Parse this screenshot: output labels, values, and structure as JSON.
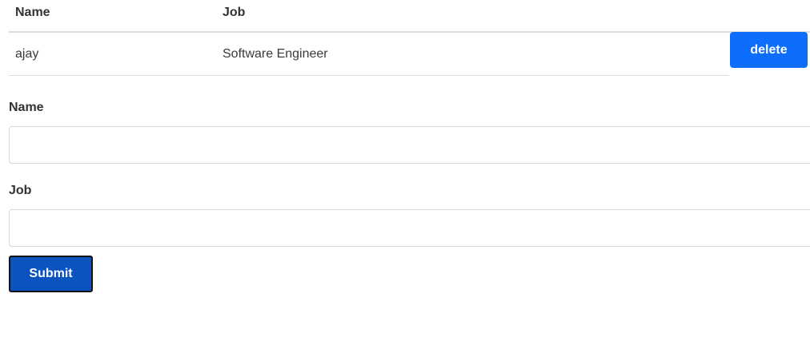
{
  "table": {
    "headers": {
      "name": "Name",
      "job": "Job"
    },
    "rows": [
      {
        "name": "ajay",
        "job": "Software Engineer",
        "delete_label": "delete"
      }
    ]
  },
  "form": {
    "name_label": "Name",
    "name_value": "",
    "job_label": "Job",
    "job_value": "",
    "submit_label": "Submit"
  },
  "colors": {
    "delete_button": "#0d6efd",
    "submit_button": "#0b53bf"
  }
}
